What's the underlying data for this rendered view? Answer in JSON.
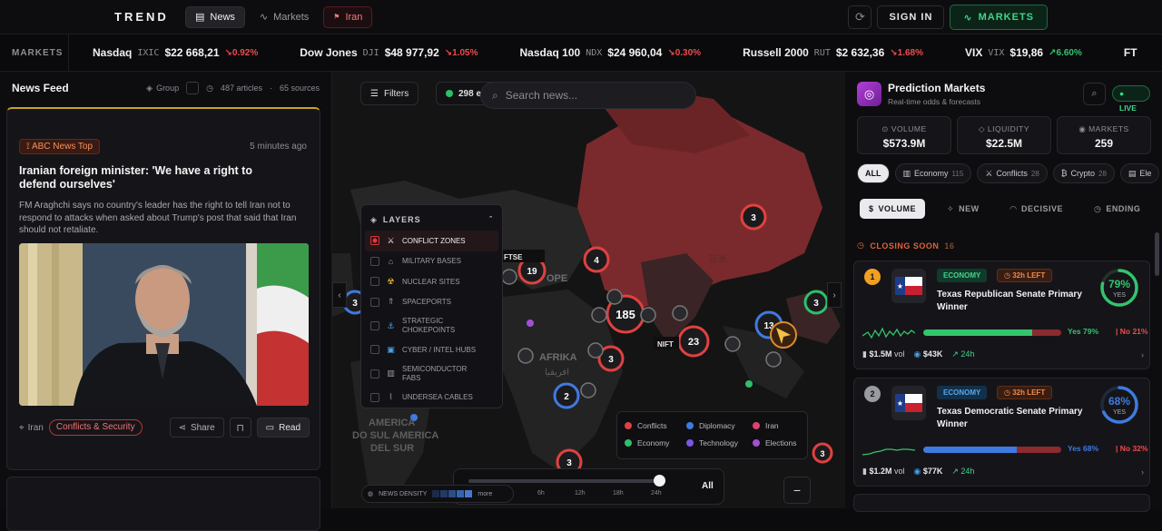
{
  "topbar": {
    "brand": "TREND",
    "tabs": [
      {
        "label": "News",
        "icon": "newspaper-icon"
      },
      {
        "label": "Markets",
        "icon": "chart-line-icon"
      },
      {
        "label": "Iran",
        "icon": "flag-icon"
      }
    ],
    "refresh_icon": "refresh-icon",
    "signin_label": "SIGN IN",
    "markets_label": "MARKETS"
  },
  "ticker": {
    "label": "MARKETS",
    "items": [
      {
        "name": "Nasdaq",
        "symbol": "IXIC",
        "price": "$22 668,21",
        "change": "0.92%",
        "direction": "down"
      },
      {
        "name": "Dow Jones",
        "symbol": "DJI",
        "price": "$48 977,92",
        "change": "1.05%",
        "direction": "down"
      },
      {
        "name": "Nasdaq 100",
        "symbol": "NDX",
        "price": "$24 960,04",
        "change": "0.30%",
        "direction": "down"
      },
      {
        "name": "Russell 2000",
        "symbol": "RUT",
        "price": "$2 632,36",
        "change": "1.68%",
        "direction": "down"
      },
      {
        "name": "VIX",
        "symbol": "VIX",
        "price": "$19,86",
        "change": "6.60%",
        "direction": "up"
      },
      {
        "name": "FT",
        "symbol": "",
        "price": "",
        "change": "",
        "direction": ""
      }
    ]
  },
  "news": {
    "title": "News Feed",
    "group_label": "Group",
    "articles": "487 articles",
    "sources": "65 sources",
    "card": {
      "source": "ABC News Top",
      "time": "5 minutes ago",
      "headline": "Iranian foreign minister: 'We have a right to defend ourselves'",
      "summary": "FM Araghchi says no country's leader has the right to tell Iran not to respond to attacks when asked about Trump's post that said that Iran should not retaliate.",
      "location": "Iran",
      "category": "Conflicts & Security",
      "share_label": "Share",
      "read_label": "Read"
    }
  },
  "map": {
    "filters_label": "Filters",
    "events_count": "298 e",
    "search_placeholder": "Search news...",
    "layers_title": "LAYERS",
    "layers": [
      {
        "label": "CONFLICT ZONES",
        "icon": "swords-icon",
        "on": true
      },
      {
        "label": "MILITARY BASES",
        "icon": "building-icon",
        "on": false
      },
      {
        "label": "NUCLEAR SITES",
        "icon": "radiation-icon",
        "on": false
      },
      {
        "label": "SPACEPORTS",
        "icon": "rocket-icon",
        "on": false
      },
      {
        "label": "STRATEGIC CHOKEPOINTS",
        "icon": "anchor-icon",
        "on": false
      },
      {
        "label": "CYBER / INTEL HUBS",
        "icon": "monitor-icon",
        "on": false
      },
      {
        "label": "SEMICONDUCTOR FABS",
        "icon": "factory-icon",
        "on": false
      },
      {
        "label": "UNDERSEA CABLES",
        "icon": "cable-icon",
        "on": false
      }
    ],
    "clusters": [
      "185",
      "23",
      "19",
      "13",
      "4",
      "3",
      "3",
      "3",
      "3",
      "2",
      "3",
      "3"
    ],
    "labels": {
      "europe": "OPE",
      "africa": "AFRIKA",
      "africa_ar": "افريقيا",
      "america": "AMERICA",
      "america2": "DO SUL AMERICA",
      "america3": "DEL SUR",
      "ftse": "FTSE",
      "nifty": "NIFT",
      "chinese": "亚洲"
    },
    "legend": [
      {
        "label": "Conflicts",
        "color": "#e0413f"
      },
      {
        "label": "Diplomacy",
        "color": "#3f7ae0"
      },
      {
        "label": "Iran",
        "color": "#e0416e"
      },
      {
        "label": "Economy",
        "color": "#2fbf6a"
      },
      {
        "label": "Technology",
        "color": "#7a55e8"
      },
      {
        "label": "Elections",
        "color": "#a24fd6"
      }
    ],
    "timeline_ticks": [
      "6h",
      "12h",
      "18h",
      "24h"
    ],
    "timeline_all": "All",
    "density_label": "NEWS DENSITY",
    "density_more": "more",
    "zoom_out": "−"
  },
  "prediction": {
    "title": "Prediction Markets",
    "subtitle": "Real-time odds & forecasts",
    "live_label": "LIVE",
    "stats": [
      {
        "key": "VOLUME",
        "value": "$573.9M"
      },
      {
        "key": "LIQUIDITY",
        "value": "$22.5M"
      },
      {
        "key": "MARKETS",
        "value": "259"
      }
    ],
    "chips": [
      {
        "label": "ALL",
        "count": ""
      },
      {
        "label": "Economy",
        "count": "115"
      },
      {
        "label": "Conflicts",
        "count": "28"
      },
      {
        "label": "Crypto",
        "count": "28"
      },
      {
        "label": "Ele",
        "count": ""
      }
    ],
    "sorts": [
      "VOLUME",
      "NEW",
      "DECISIVE",
      "ENDING"
    ],
    "closing_label": "CLOSING SOON",
    "closing_count": "16",
    "markets": [
      {
        "rank": "1",
        "category": "ECONOMY",
        "time_left": "32h LEFT",
        "title": "Texas Republican Senate Primary Winner",
        "percent": "79%",
        "yes_label": "YES",
        "yes_text": "Yes 79%",
        "no_text": "No 21%",
        "yes_fraction": 0.79,
        "vol": "$1.5M",
        "vol_suffix": "vol",
        "liq": "$43K",
        "trend": "24h",
        "rank_color": "#f0a020",
        "accent": "#33c46e"
      },
      {
        "rank": "2",
        "category": "ECONOMY",
        "time_left": "32h LEFT",
        "title": "Texas Democratic Senate Primary Winner",
        "percent": "68%",
        "yes_label": "YES",
        "yes_text": "Yes 68%",
        "no_text": "No 32%",
        "yes_fraction": 0.68,
        "vol": "$1.2M",
        "vol_suffix": "vol",
        "liq": "$77K",
        "trend": "24h",
        "rank_color": "#9a9aa2",
        "accent": "#3f7ae0"
      }
    ]
  }
}
